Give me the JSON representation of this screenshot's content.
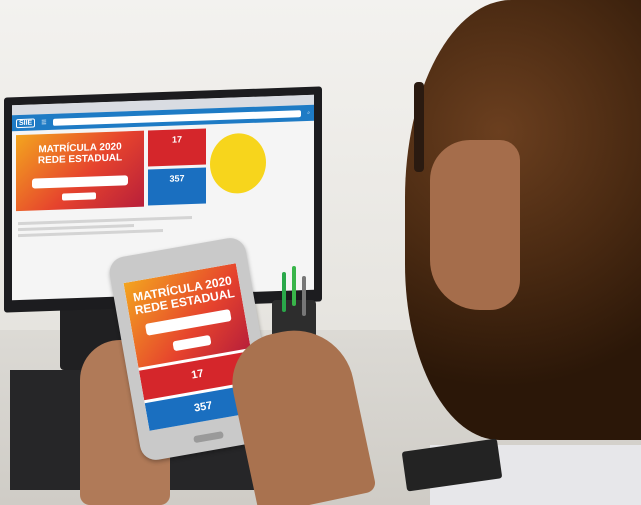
{
  "monitor": {
    "browser_tab": "",
    "site_logo": "SIIE",
    "hero_title_line1": "MATRÍCULA 2020",
    "hero_title_line2": "REDE ESTADUAL",
    "stat_red_value": "17",
    "stat_blue_value": "357"
  },
  "phone": {
    "hero_title_line1": "MATRÍCULA 2020",
    "hero_title_line2": "REDE ESTADUAL",
    "stat_red_value": "17",
    "stat_blue_value": "357"
  },
  "colors": {
    "brand_blue": "#1a6fc0",
    "brand_red": "#d5262b",
    "hero_orange": "#f3a51f",
    "promo_yellow": "#f7d51c"
  }
}
